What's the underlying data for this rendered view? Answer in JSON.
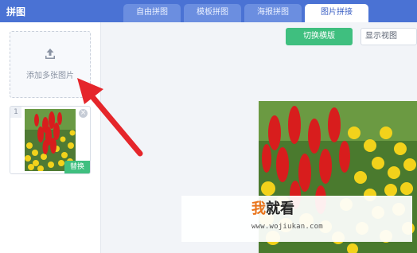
{
  "app": {
    "title": "拼图"
  },
  "tabs": [
    {
      "label": "自由拼图",
      "active": false
    },
    {
      "label": "模板拼图",
      "active": false
    },
    {
      "label": "海报拼图",
      "active": false
    },
    {
      "label": "图片拼接",
      "active": true
    }
  ],
  "sidebar": {
    "upload": {
      "icon": "upload-icon",
      "label": "添加多张图片"
    },
    "thumbnail": {
      "index": "1",
      "replace_label": "替换",
      "close_icon": "close-icon"
    }
  },
  "toolbar": {
    "switch_button_label": "切换横版",
    "view_select_value": "显示视图"
  },
  "watermark": {
    "logo_char_1": "我",
    "logo_chars_rest": "就看",
    "url": "www.wojiukan.com"
  },
  "colors": {
    "topbar": "#4a72d4",
    "accent_green": "#3fbf7f",
    "arrow_red": "#e5262b",
    "watermark_orange": "#e8731a"
  }
}
